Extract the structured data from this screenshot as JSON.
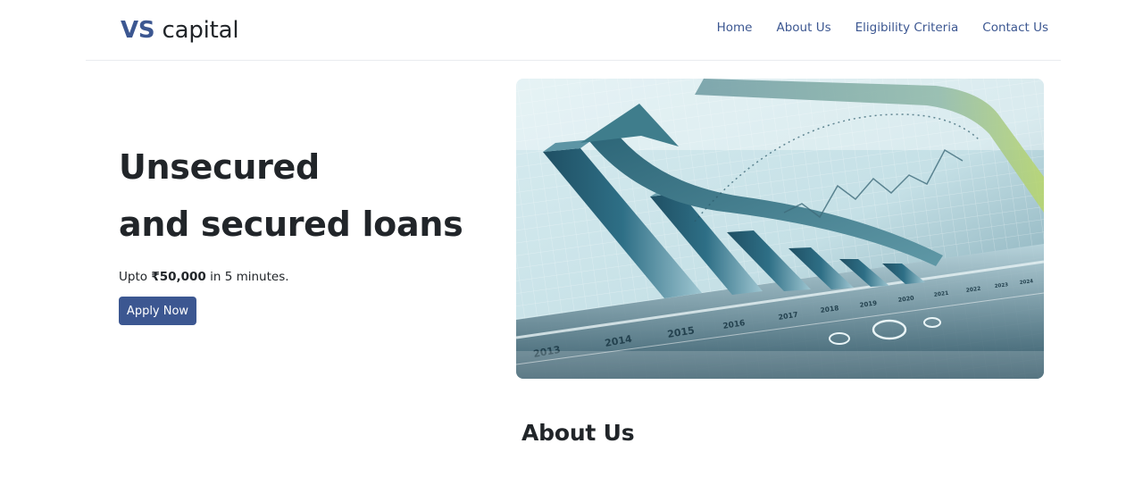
{
  "brand": {
    "prefix": "VS",
    "name": "capital"
  },
  "nav": {
    "items": [
      {
        "label": "Home"
      },
      {
        "label": "About Us"
      },
      {
        "label": "Eligibility Criteria"
      },
      {
        "label": "Contact Us"
      }
    ]
  },
  "hero": {
    "title_line1": "Unsecured",
    "title_line2": "and secured loans",
    "sub_prefix": "Upto",
    "sub_amount": "₹50,000",
    "sub_suffix": "in 5 minutes.",
    "button_label": "Apply Now",
    "image_years": [
      "2013",
      "2014",
      "2015",
      "2016",
      "2017",
      "2018",
      "2019",
      "2020",
      "2021",
      "2022",
      "2023",
      "2024"
    ]
  },
  "about": {
    "heading": "About Us"
  },
  "colors": {
    "brand": "#3c5791",
    "text": "#212529",
    "divider": "#e9ecef"
  }
}
